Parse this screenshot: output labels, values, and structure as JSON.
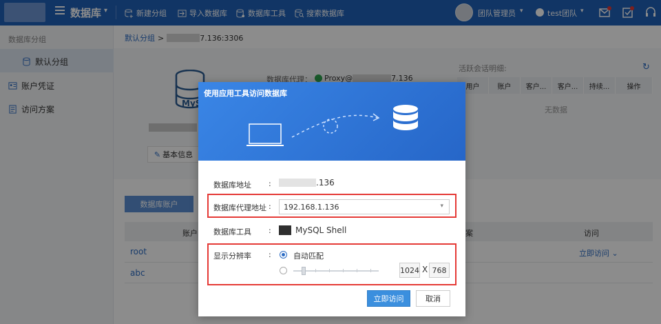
{
  "topbar": {
    "title": "数据库",
    "actions": [
      "新建分组",
      "导入数据库",
      "数据库工具",
      "搜索数据库"
    ],
    "user_name": "团队管理员",
    "team_name": "test团队"
  },
  "sidebar": {
    "heading": "数据库分组",
    "items": [
      {
        "label": "默认分组"
      },
      {
        "label": "账户凭证"
      },
      {
        "label": "访问方案"
      }
    ]
  },
  "breadcrumb": {
    "group": "默认分组",
    "separator": ">",
    "target_suffix": "7.136:3306"
  },
  "overview": {
    "logo_text": "MyS",
    "proxy_label": "数据库代理：",
    "proxy_prefix": "Proxy@",
    "proxy_suffix": "7.136",
    "basic_info": "基本信息",
    "session_label": "活跃会话明细:",
    "session_columns": [
      "用户",
      "账户",
      "客户...",
      "客户...",
      "持续...",
      "操作"
    ],
    "session_empty": "无数据"
  },
  "accounts": {
    "tab": "数据库账户",
    "col_account": "账户",
    "col_mid": "案",
    "col_access": "访问",
    "rows": [
      {
        "name": "root",
        "access": "立即访问"
      },
      {
        "name": "abc"
      }
    ]
  },
  "modal": {
    "title": "使用应用工具访问数据库",
    "addr_label": "数据库地址",
    "addr_suffix": ".136",
    "proxy_label": "数据库代理地址",
    "proxy_value": "192.168.1.136",
    "tool_label": "数据库工具",
    "tool_value": "MySQL Shell",
    "res_label": "显示分辨率",
    "auto_label": "自动匹配",
    "colon": ":",
    "width": "1024",
    "x": "X",
    "height": "768",
    "ok": "立即访问",
    "cancel": "取消"
  },
  "colors": {
    "topbar": "#1f61b9",
    "accent": "#3b8fde",
    "highlight": "#e53935"
  }
}
